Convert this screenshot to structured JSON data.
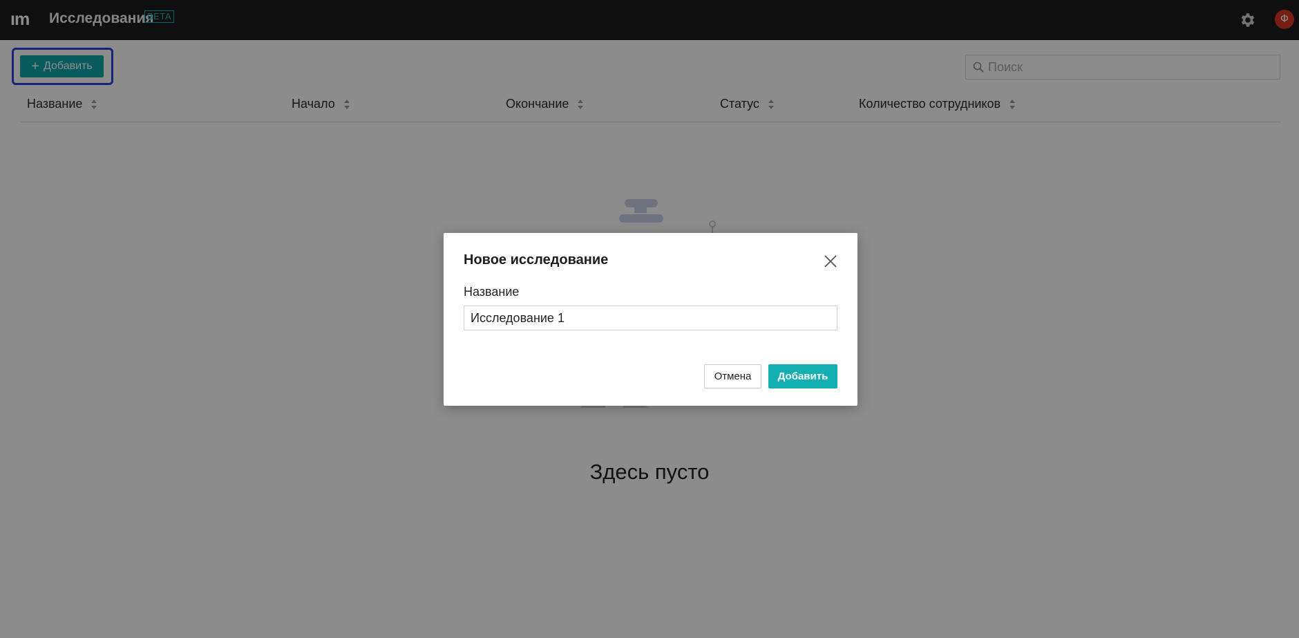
{
  "header": {
    "logo_text": "ım",
    "title": "Исследования",
    "badge": "BETA",
    "settings_icon": "gear-icon",
    "avatar_initial": "Ф",
    "avatar_color": "#d9361f"
  },
  "toolbar": {
    "add_label": "Добавить",
    "add_icon": "plus-icon",
    "search_placeholder": "Поиск",
    "search_icon": "search-icon"
  },
  "table": {
    "columns": [
      {
        "label": "Название"
      },
      {
        "label": "Начало"
      },
      {
        "label": "Окончание"
      },
      {
        "label": "Статус"
      },
      {
        "label": "Количество сотрудников"
      }
    ],
    "rows": []
  },
  "empty_state": {
    "text": "Здесь пусто",
    "illustration": "person-with-box-illustration"
  },
  "modal": {
    "title": "Новое исследование",
    "field_label": "Название",
    "field_value": "Исследование 1",
    "cancel_label": "Отмена",
    "submit_label": "Добавить",
    "close_icon": "close-icon"
  },
  "colors": {
    "accent": "#12b0b2",
    "topbar": "#1c1c1c",
    "focus_ring": "#2d3fd8"
  }
}
